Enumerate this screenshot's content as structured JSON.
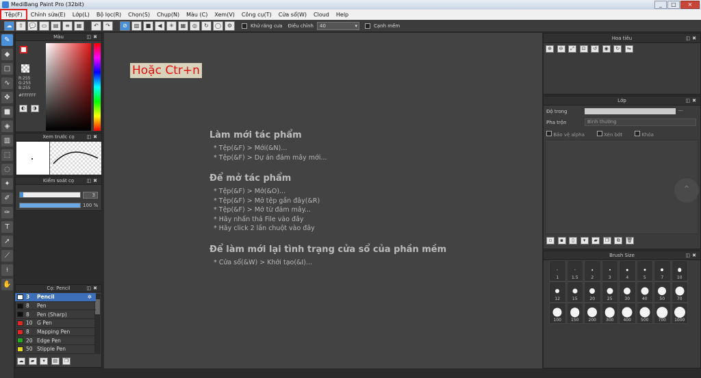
{
  "window": {
    "title": "MediBang Paint Pro (32bit)",
    "controls": [
      "_",
      "□",
      "×"
    ]
  },
  "menu": [
    "Tệp(F)",
    "Chỉnh sửa(E)",
    "Lớp(L)",
    "Bộ lọc(R)",
    "Chọn(S)",
    "Chụp(N)",
    "Màu (C)",
    "Xem(V)",
    "Công cụ(T)",
    "Cửa sổ(W)",
    "Cloud",
    "Help"
  ],
  "toolbar": {
    "antialias_label": "Khử răng cưa",
    "adjust_label": "Điều chỉnh",
    "adjust_value": "40",
    "edge_label": "Cạnh mềm"
  },
  "color_panel": {
    "title": "Màu",
    "r": "R:255",
    "g": "G:255",
    "b": "B:255",
    "hex": "#FFFFFF"
  },
  "preview_panel": {
    "title": "Xem trước cọ"
  },
  "brush_control": {
    "title": "Kiểm soát cọ",
    "size": "3",
    "opacity": "100 %",
    "size_fraction": 0.02,
    "opacity_fraction": 1.0
  },
  "brush_list": {
    "title": "Cọ: Pencil",
    "items": [
      {
        "size": "3",
        "name": "Pencil",
        "color": "#ffffff"
      },
      {
        "size": "8",
        "name": "Pen",
        "color": "#111111"
      },
      {
        "size": "8",
        "name": "Pen (Sharp)",
        "color": "#111111"
      },
      {
        "size": "10",
        "name": "G Pen",
        "color": "#e02828"
      },
      {
        "size": "8",
        "name": "Mapping Pen",
        "color": "#e02828"
      },
      {
        "size": "20",
        "name": "Edge Pen",
        "color": "#22aa22"
      },
      {
        "size": "50",
        "name": "Stipple Pen",
        "color": "#e8d820"
      }
    ]
  },
  "canvas": {
    "red_label": "Hoặc Ctr+n",
    "sections": [
      {
        "heading": "Làm mới tác phẩm",
        "lines": [
          "* Tệp(&F) > Mới(&N)...",
          "* Tệp(&F) > Dự án đám mây mới..."
        ]
      },
      {
        "heading": "Để mở tác phẩm",
        "lines": [
          "* Tệp(&F) > Mở(&O)...",
          "* Tệp(&F) > Mở tệp gần đây(&R)",
          "* Tệp(&F) > Mở từ đám mây...",
          "* Hãy nhấn thả File vào đây",
          "* Hãy click 2 lần chuột vào đây"
        ]
      },
      {
        "heading": "Để làm mới lại tình trạng cửa sổ của phần mềm",
        "lines": [
          "* Cửa sổ(&W) > Khởi tạo(&I)..."
        ]
      }
    ]
  },
  "navigator": {
    "title": "Hoa tiêu"
  },
  "layer_panel": {
    "title": "Lớp",
    "opacity_label": "Độ trong",
    "opacity_value": "---",
    "blend_label": "Pha trộn",
    "blend_value": "Bình thường",
    "protect_alpha": "Bảo vệ alpha",
    "clipping": "Xén bớt",
    "lock": "Khóa"
  },
  "brush_size": {
    "title": "Brush Size",
    "rows": [
      [
        "1",
        "1.5",
        "2",
        "3",
        "4",
        "5",
        "7",
        "10"
      ],
      [
        "12",
        "15",
        "20",
        "25",
        "30",
        "40",
        "50",
        "70"
      ],
      [
        "100",
        "150",
        "200",
        "300",
        "400",
        "500",
        "700",
        "1000"
      ]
    ]
  }
}
